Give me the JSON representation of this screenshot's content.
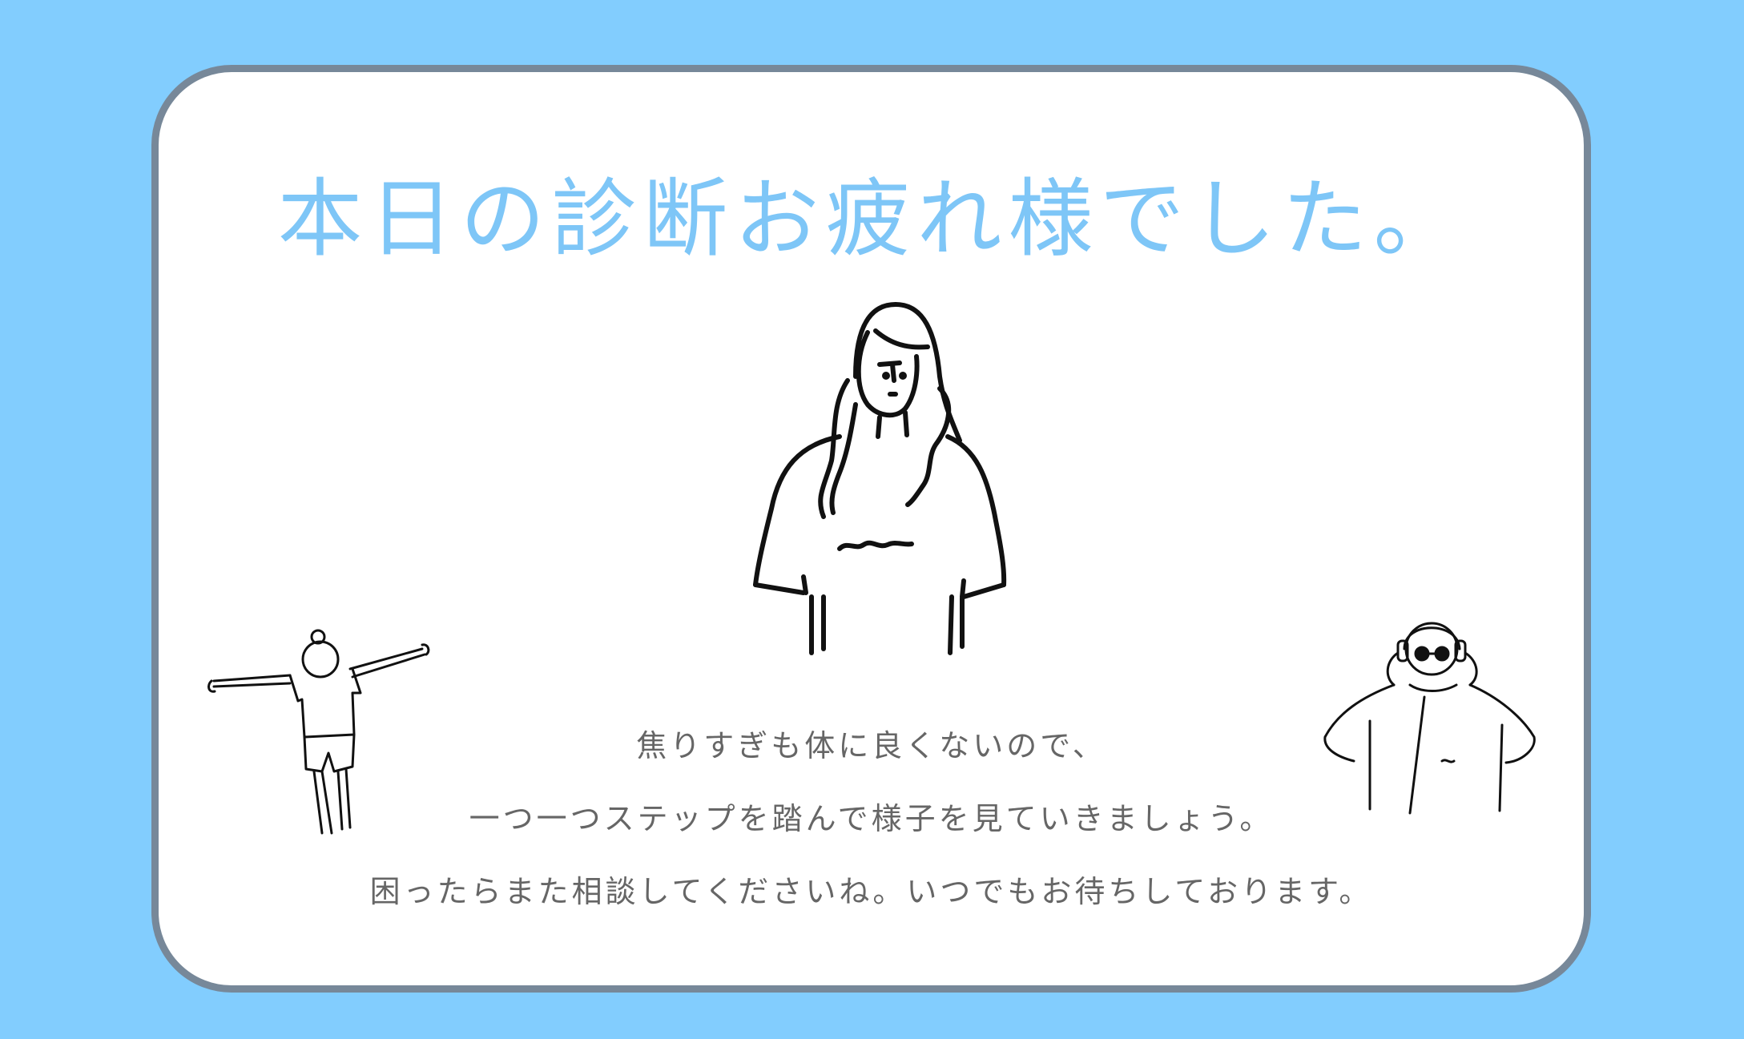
{
  "colors": {
    "background": "#82cdfe",
    "card_border": "#778899",
    "title": "#7ec6f7",
    "message_text": "#666666"
  },
  "title": "本日の診断お疲れ様でした。",
  "message": {
    "line1": "焦りすぎも体に良くないので、",
    "line2": "一つ一つステップを踏んで様子を見ていきましょう。",
    "line3": "困ったらまた相談してくださいね。いつでもお待ちしております。"
  },
  "illustrations": [
    "woman-long-hair-illustration",
    "person-stretching-arms-illustration",
    "person-with-headphones-illustration"
  ]
}
